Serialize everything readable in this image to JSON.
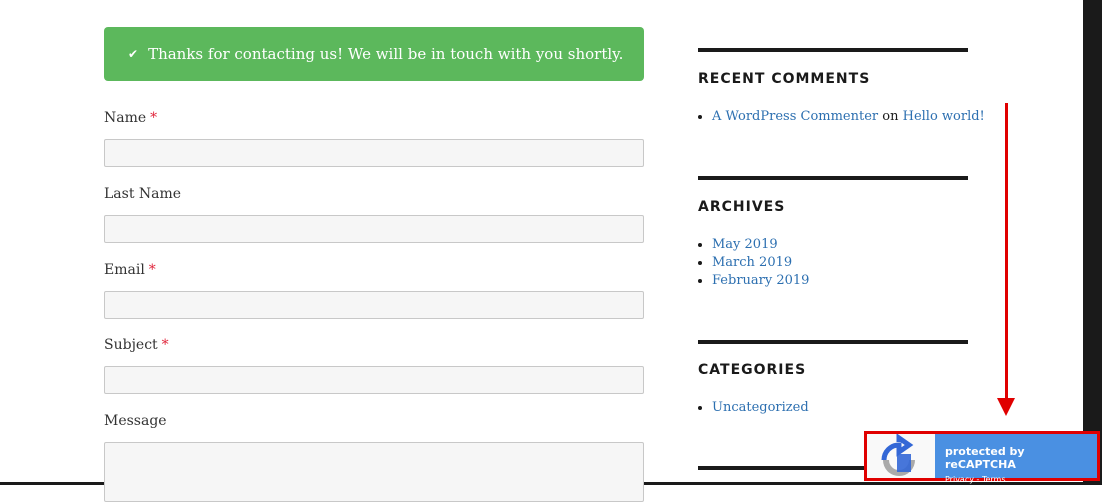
{
  "form": {
    "success_message": "Thanks for contacting us! We will be in touch with you shortly.",
    "success_icon": "check-icon",
    "required_mark": "*",
    "fields": {
      "name": {
        "label": "Name",
        "value": ""
      },
      "last_name": {
        "label": "Last Name",
        "value": ""
      },
      "email": {
        "label": "Email",
        "value": ""
      },
      "subject": {
        "label": "Subject",
        "value": ""
      },
      "message": {
        "label": "Message",
        "value": ""
      }
    }
  },
  "sidebar": {
    "recent_comments": {
      "title": "RECENT COMMENTS",
      "author": "A WordPress Commenter",
      "connector": "on",
      "post": "Hello world!"
    },
    "archives": {
      "title": "ARCHIVES",
      "items": [
        "May 2019",
        "March 2019",
        "February 2019"
      ]
    },
    "categories": {
      "title": "CATEGORIES",
      "items": [
        "Uncategorized"
      ]
    }
  },
  "recaptcha": {
    "protected_text": "protected by reCAPTCHA",
    "privacy": "Privacy",
    "separator": " - ",
    "terms": "Terms"
  },
  "colors": {
    "success_bg": "#5cb85c",
    "link": "#2c6fb0",
    "required": "#e0243a",
    "annotation": "#e00000",
    "recaptcha_blue": "#4a90e2"
  }
}
